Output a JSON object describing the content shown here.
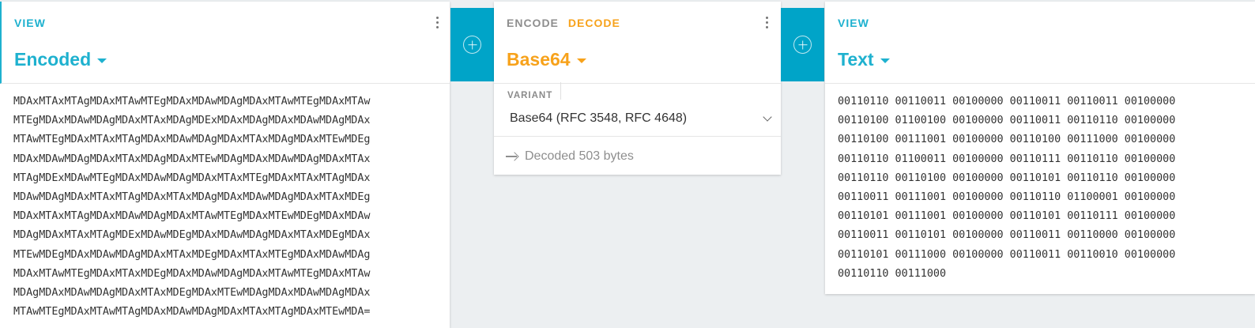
{
  "left_panel": {
    "tab": "VIEW",
    "format": "Encoded",
    "lines": [
      "MDAxMTAxMTAgMDAxMTAwMTEgMDAxMDAwMDAgMDAxMTAwMTEgMDAxMTAw",
      "MTEgMDAxMDAwMDAgMDAxMTAxMDAgMDExMDAxMDAgMDAxMDAwMDAgMDAx",
      "MTAwMTEgMDAxMTAxMTAgMDAxMDAwMDAgMDAxMTAxMDAgMDAxMTEwMDEg",
      "MDAxMDAwMDAgMDAxMTAxMDAgMDAxMTEwMDAgMDAxMDAwMDAgMDAxMTAx",
      "MTAgMDExMDAwMTEgMDAxMDAwMDAgMDAxMTAxMTEgMDAxMTAxMTAgMDAx",
      "MDAwMDAgMDAxMTAxMTAgMDAxMTAxMDAgMDAxMDAwMDAgMDAxMTAxMDEg",
      "MDAxMTAxMTAgMDAxMDAwMDAgMDAxMTAwMTEgMDAxMTEwMDEgMDAxMDAw",
      "MDAgMDAxMTAxMTAgMDExMDAwMDEgMDAxMDAwMDAgMDAxMTAxMDEgMDAx",
      "MTEwMDEgMDAxMDAwMDAgMDAxMTAxMDEgMDAxMTAxMTEgMDAxMDAwMDAg",
      "MDAxMTAwMTEgMDAxMTAxMDEgMDAxMDAwMDAgMDAxMTAwMTEgMDAxMTAw",
      "MDAgMDAxMDAwMDAgMDAxMTAxMDEgMDAxMTEwMDAgMDAxMDAwMDAgMDAx",
      "MTAwMTEgMDAxMTAwMTAgMDAxMDAwMDAgMDAxMTAxMTAgMDAxMTEwMDA="
    ]
  },
  "middle_panel": {
    "encode_tab": "ENCODE",
    "decode_tab": "DECODE",
    "format": "Base64",
    "variant_label": "VARIANT",
    "variant_value": "Base64 (RFC 3548, RFC 4648)",
    "status": "Decoded 503 bytes"
  },
  "right_panel": {
    "tab": "VIEW",
    "format": "Text",
    "lines": [
      "00110110 00110011 00100000 00110011 00110011 00100000",
      "00110100 01100100 00100000 00110011 00110110 00100000",
      "00110100 00111001 00100000 00110100 00111000 00100000",
      "00110110 01100011 00100000 00110111 00110110 00100000",
      "00110110 00110100 00100000 00110101 00110110 00100000",
      "00110011 00111001 00100000 00110110 01100001 00100000",
      "00110101 00111001 00100000 00110101 00110111 00100000",
      "00110011 00110101 00100000 00110011 00110000 00100000",
      "00110101 00111000 00100000 00110011 00110010 00100000",
      "00110110 00111000"
    ]
  },
  "colors": {
    "view_accent": "#1eb1cf",
    "decode_accent": "#f7a21b",
    "add_bar": "#00a4c8",
    "background": "#eceff1"
  }
}
